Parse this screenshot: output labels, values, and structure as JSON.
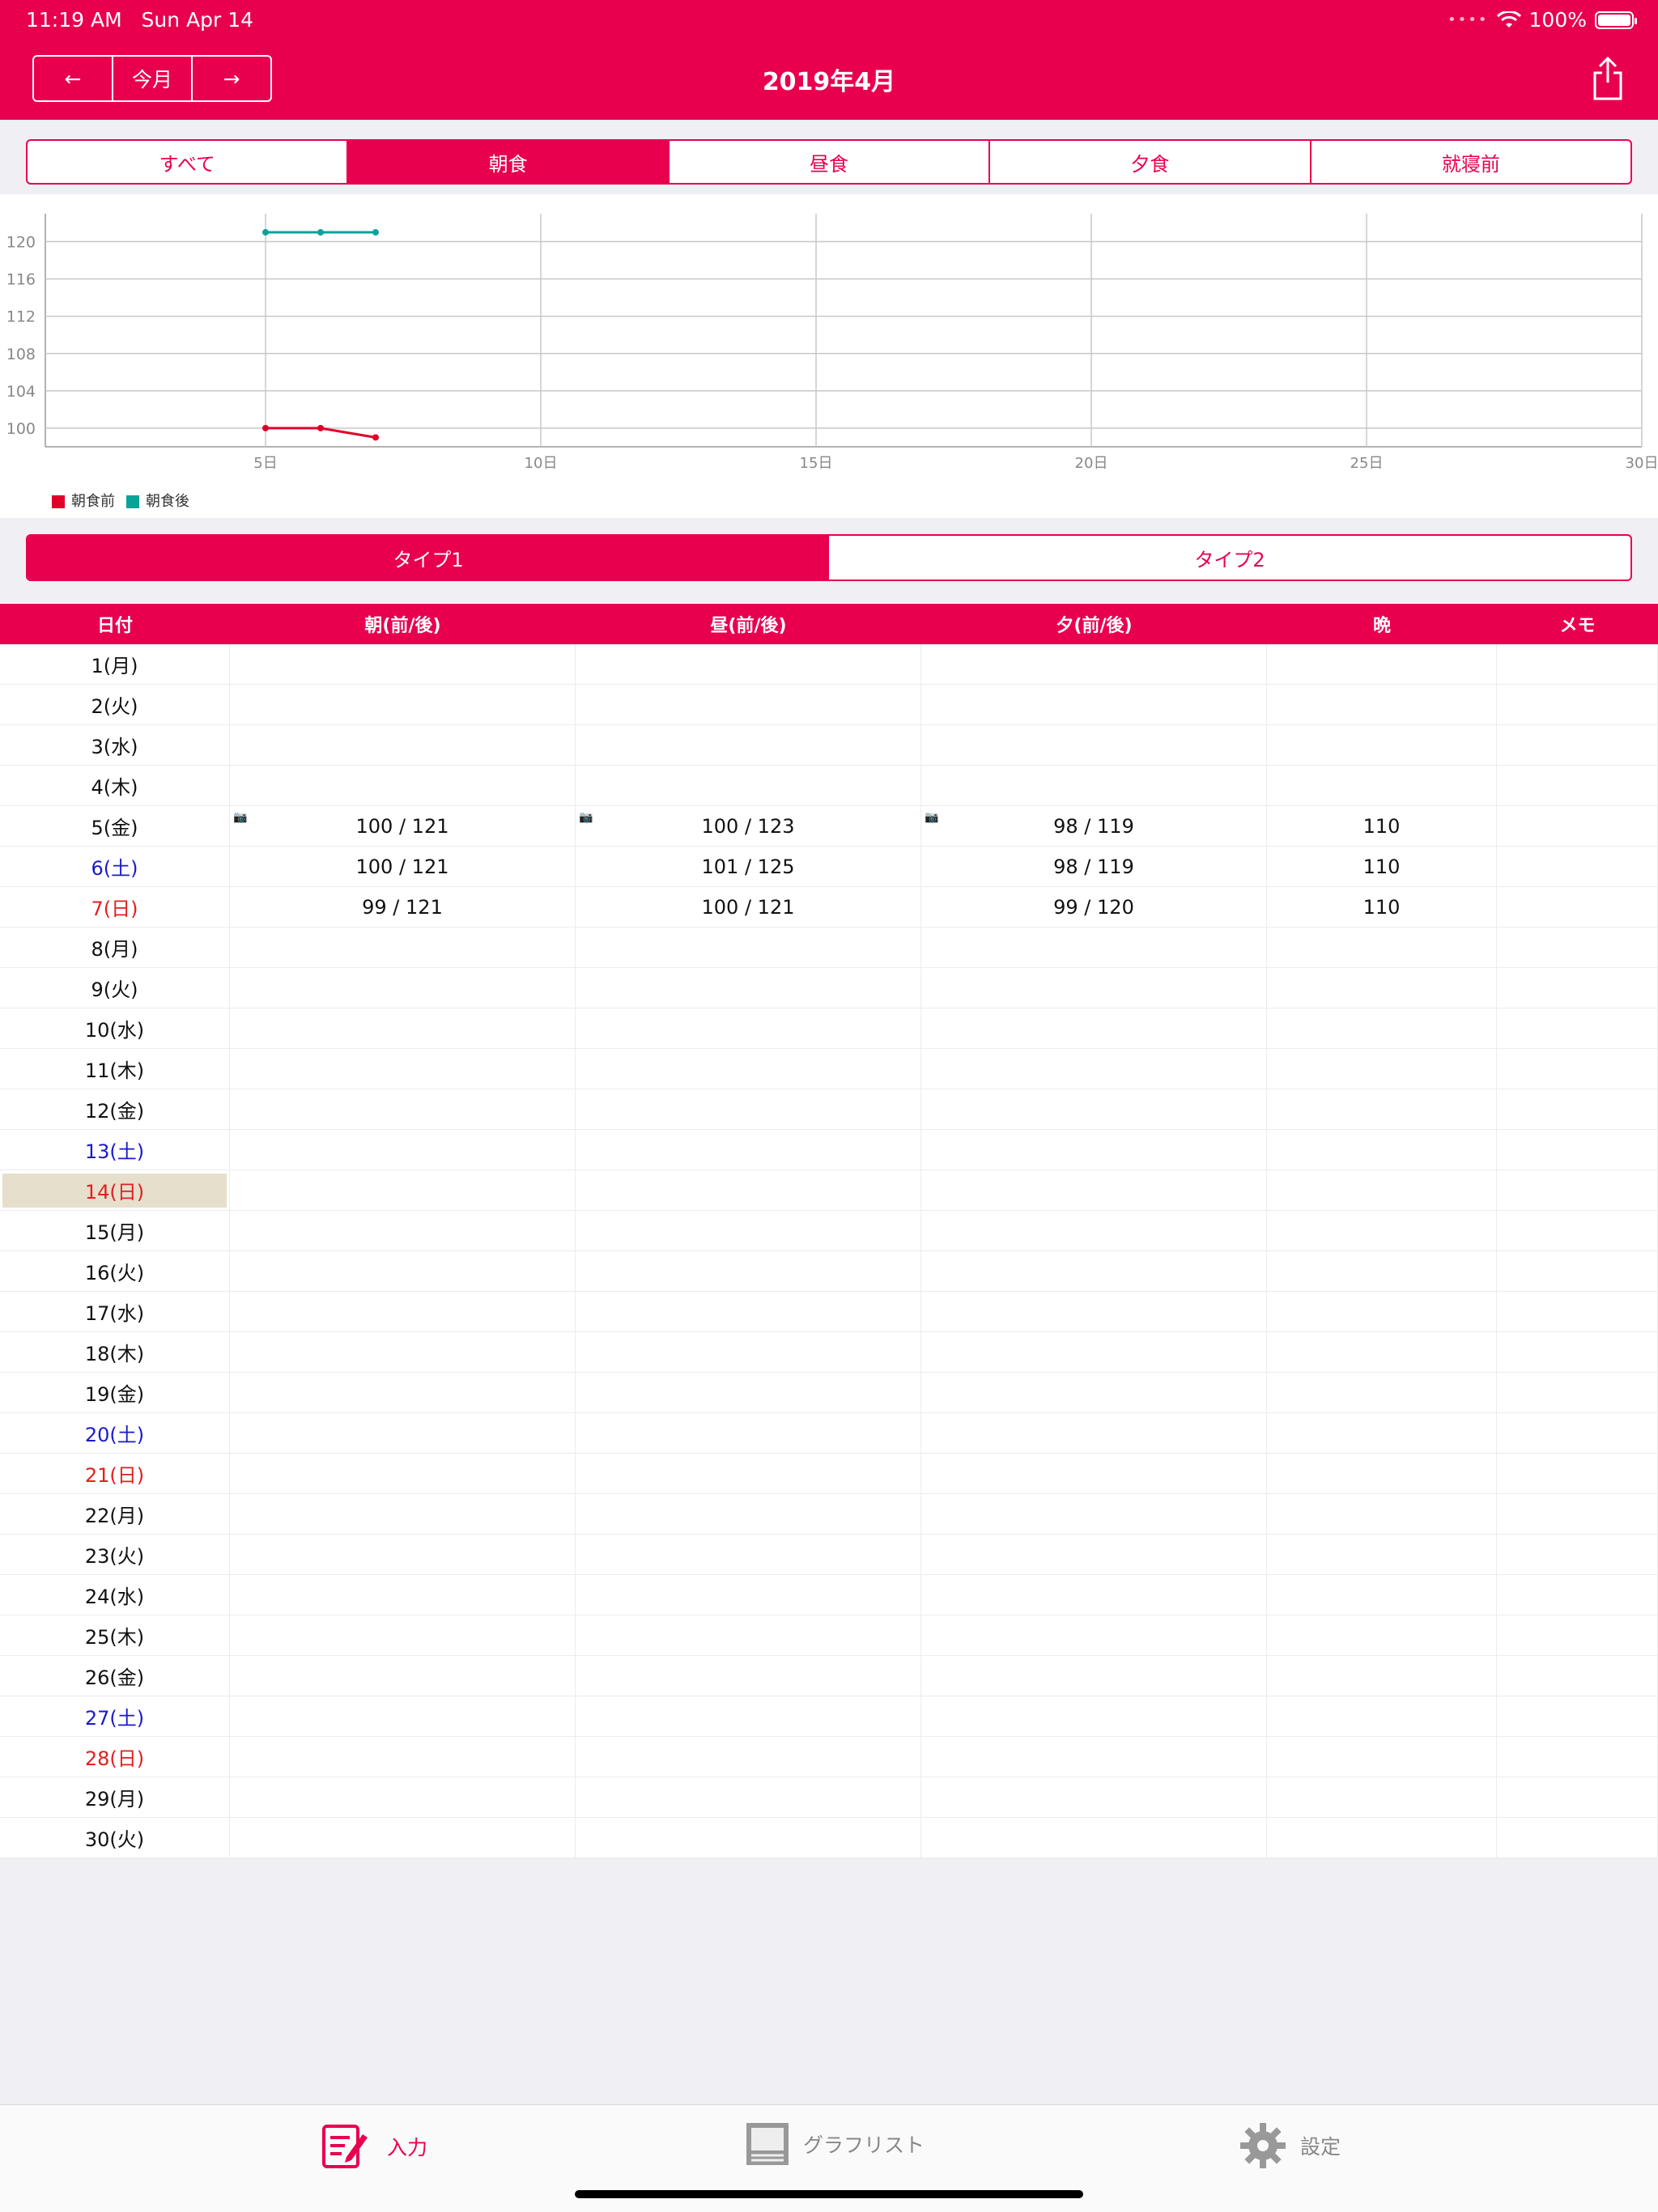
{
  "status": {
    "time": "11:19 AM",
    "date": "Sun Apr 14",
    "battery": "100%"
  },
  "header": {
    "prev": "←",
    "today": "今月",
    "next": "→",
    "title": "2019年4月"
  },
  "meal_tabs": [
    {
      "label": "すべて",
      "active": false
    },
    {
      "label": "朝食",
      "active": true
    },
    {
      "label": "昼食",
      "active": false
    },
    {
      "label": "夕食",
      "active": false
    },
    {
      "label": "就寝前",
      "active": false
    }
  ],
  "chart_data": {
    "type": "line",
    "x_ticks": [
      5,
      10,
      15,
      20,
      25,
      30
    ],
    "x_tick_labels": [
      "5日",
      "10日",
      "15日",
      "20日",
      "25日",
      "30日"
    ],
    "y_ticks": [
      100,
      104,
      108,
      112,
      116,
      120
    ],
    "ylim": [
      98,
      123
    ],
    "xlim": [
      1,
      30
    ],
    "series": [
      {
        "name": "朝食前",
        "color": "#e0002a",
        "x": [
          5,
          6,
          7
        ],
        "y": [
          100,
          100,
          99
        ]
      },
      {
        "name": "朝食後",
        "color": "#0aa39a",
        "x": [
          5,
          6,
          7
        ],
        "y": [
          121,
          121,
          121
        ]
      }
    ]
  },
  "type_tabs": [
    {
      "label": "タイプ1",
      "active": true
    },
    {
      "label": "タイプ2",
      "active": false
    }
  ],
  "table": {
    "headers": [
      "日付",
      "朝(前/後)",
      "昼(前/後)",
      "夕(前/後)",
      "晩",
      "メモ"
    ],
    "rows": [
      {
        "date": "1(月)",
        "kind": "",
        "m": "",
        "l": "",
        "d": "",
        "n": "",
        "cam": false
      },
      {
        "date": "2(火)",
        "kind": "",
        "m": "",
        "l": "",
        "d": "",
        "n": "",
        "cam": false
      },
      {
        "date": "3(水)",
        "kind": "",
        "m": "",
        "l": "",
        "d": "",
        "n": "",
        "cam": false
      },
      {
        "date": "4(木)",
        "kind": "",
        "m": "",
        "l": "",
        "d": "",
        "n": "",
        "cam": false
      },
      {
        "date": "5(金)",
        "kind": "",
        "m": "100 / 121",
        "l": "100 / 123",
        "d": "98 / 119",
        "n": "110",
        "cam": true
      },
      {
        "date": "6(土)",
        "kind": "sat",
        "m": "100 / 121",
        "l": "101 / 125",
        "d": "98 / 119",
        "n": "110",
        "cam": false
      },
      {
        "date": "7(日)",
        "kind": "sun",
        "m": "99 / 121",
        "l": "100 / 121",
        "d": "99 / 120",
        "n": "110",
        "cam": false
      },
      {
        "date": "8(月)",
        "kind": "",
        "m": "",
        "l": "",
        "d": "",
        "n": "",
        "cam": false
      },
      {
        "date": "9(火)",
        "kind": "",
        "m": "",
        "l": "",
        "d": "",
        "n": "",
        "cam": false
      },
      {
        "date": "10(水)",
        "kind": "",
        "m": "",
        "l": "",
        "d": "",
        "n": "",
        "cam": false
      },
      {
        "date": "11(木)",
        "kind": "",
        "m": "",
        "l": "",
        "d": "",
        "n": "",
        "cam": false
      },
      {
        "date": "12(金)",
        "kind": "",
        "m": "",
        "l": "",
        "d": "",
        "n": "",
        "cam": false
      },
      {
        "date": "13(土)",
        "kind": "sat",
        "m": "",
        "l": "",
        "d": "",
        "n": "",
        "cam": false
      },
      {
        "date": "14(日)",
        "kind": "sun today",
        "m": "",
        "l": "",
        "d": "",
        "n": "",
        "cam": false
      },
      {
        "date": "15(月)",
        "kind": "",
        "m": "",
        "l": "",
        "d": "",
        "n": "",
        "cam": false
      },
      {
        "date": "16(火)",
        "kind": "",
        "m": "",
        "l": "",
        "d": "",
        "n": "",
        "cam": false
      },
      {
        "date": "17(水)",
        "kind": "",
        "m": "",
        "l": "",
        "d": "",
        "n": "",
        "cam": false
      },
      {
        "date": "18(木)",
        "kind": "",
        "m": "",
        "l": "",
        "d": "",
        "n": "",
        "cam": false
      },
      {
        "date": "19(金)",
        "kind": "",
        "m": "",
        "l": "",
        "d": "",
        "n": "",
        "cam": false
      },
      {
        "date": "20(土)",
        "kind": "sat",
        "m": "",
        "l": "",
        "d": "",
        "n": "",
        "cam": false
      },
      {
        "date": "21(日)",
        "kind": "sun",
        "m": "",
        "l": "",
        "d": "",
        "n": "",
        "cam": false
      },
      {
        "date": "22(月)",
        "kind": "",
        "m": "",
        "l": "",
        "d": "",
        "n": "",
        "cam": false
      },
      {
        "date": "23(火)",
        "kind": "",
        "m": "",
        "l": "",
        "d": "",
        "n": "",
        "cam": false
      },
      {
        "date": "24(水)",
        "kind": "",
        "m": "",
        "l": "",
        "d": "",
        "n": "",
        "cam": false
      },
      {
        "date": "25(木)",
        "kind": "",
        "m": "",
        "l": "",
        "d": "",
        "n": "",
        "cam": false
      },
      {
        "date": "26(金)",
        "kind": "",
        "m": "",
        "l": "",
        "d": "",
        "n": "",
        "cam": false
      },
      {
        "date": "27(土)",
        "kind": "sat",
        "m": "",
        "l": "",
        "d": "",
        "n": "",
        "cam": false
      },
      {
        "date": "28(日)",
        "kind": "sun",
        "m": "",
        "l": "",
        "d": "",
        "n": "",
        "cam": false
      },
      {
        "date": "29(月)",
        "kind": "",
        "m": "",
        "l": "",
        "d": "",
        "n": "",
        "cam": false
      },
      {
        "date": "30(火)",
        "kind": "",
        "m": "",
        "l": "",
        "d": "",
        "n": "",
        "cam": false
      }
    ]
  },
  "tabbar": [
    {
      "label": "入力",
      "icon": "notepad-edit-icon",
      "active": true
    },
    {
      "label": "グラフリスト",
      "icon": "graph-list-icon",
      "active": false
    },
    {
      "label": "設定",
      "icon": "gear-icon",
      "active": false
    }
  ],
  "colors": {
    "accent": "#e8004f",
    "saturday": "#1a1acc",
    "sunday": "#e02020",
    "today_bg": "#e6dfcc"
  }
}
